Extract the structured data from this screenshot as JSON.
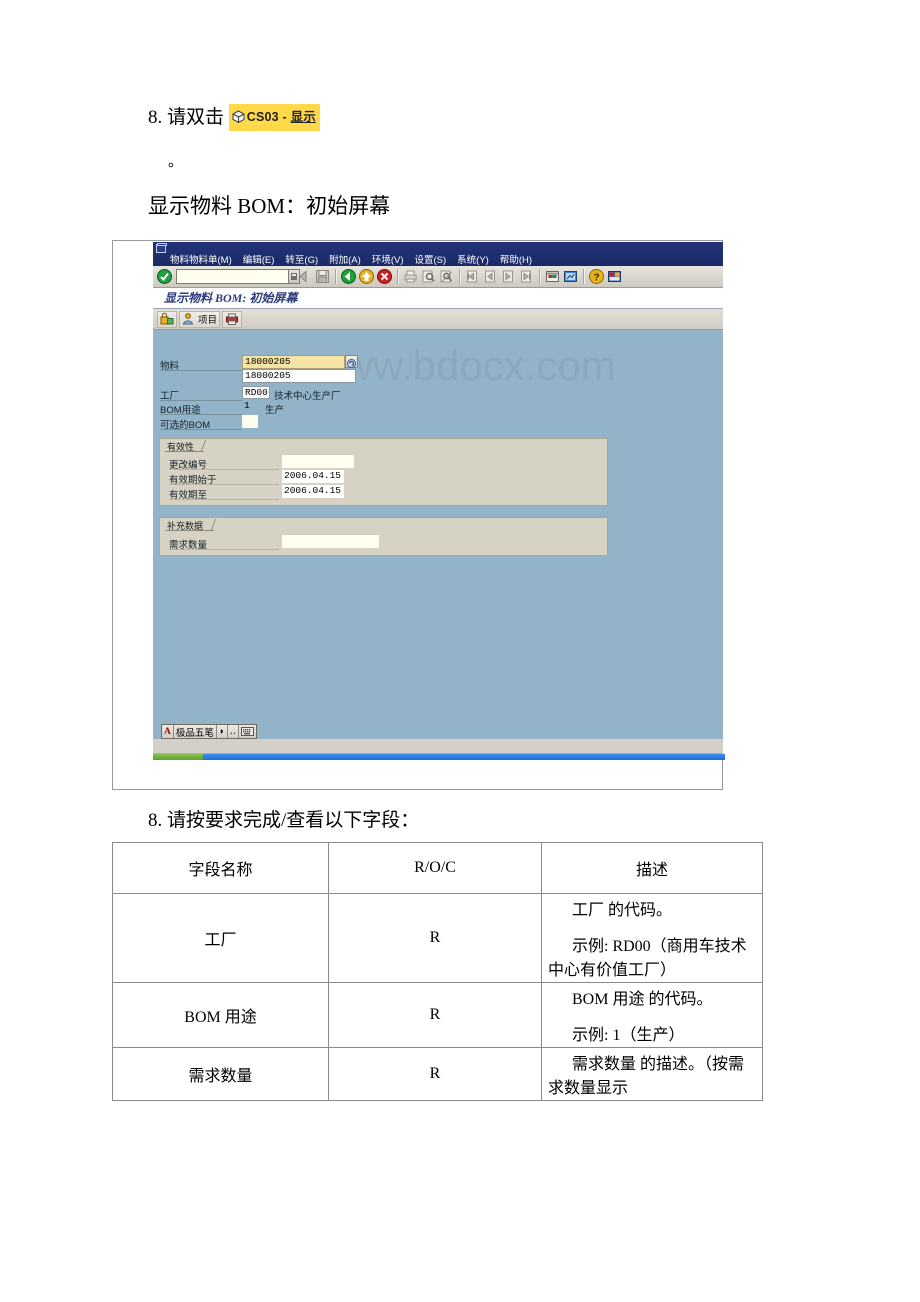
{
  "document": {
    "step_8_prefix": "8. 请双击",
    "cs_chip": {
      "code": "CS03",
      "dash": "-",
      "label": "显示",
      "icon": "cube-icon"
    },
    "dot_line": "。",
    "screen_heading": "显示物料 BOM：初始屏幕",
    "step_8_fields": "8. 请按要求完成/查看以下字段："
  },
  "sap": {
    "system_icon": "sap-system-menu-icon",
    "menus": [
      {
        "label": "物料物料单(M)",
        "accesskey": "M"
      },
      {
        "label": "编辑(E)",
        "accesskey": "E"
      },
      {
        "label": "转至(G)",
        "accesskey": "G"
      },
      {
        "label": "附加(A)",
        "accesskey": "A"
      },
      {
        "label": "环境(V)",
        "accesskey": "V"
      },
      {
        "label": "设置(S)",
        "accesskey": "S"
      },
      {
        "label": "系统(Y)",
        "accesskey": "Y"
      },
      {
        "label": "帮助(H)",
        "accesskey": "H"
      }
    ],
    "command_field": {
      "value": "",
      "placeholder": ""
    },
    "toolbar_icons": [
      "enter-green-check-icon",
      "back-arrow-icon",
      "save-icon",
      "back-green-icon",
      "exit-yellow-icon",
      "cancel-red-icon",
      "print-icon",
      "find-icon",
      "find-next-icon",
      "first-page-icon",
      "previous-page-icon",
      "next-page-icon",
      "last-page-icon",
      "create-session-icon",
      "create-shortcut-icon",
      "help-icon",
      "customize-layout-icon"
    ],
    "window_title": "显示物料 BOM:  初始屏幕",
    "app_toolbar": [
      {
        "name": "bom-group-button",
        "icon": "bom-lock-icon",
        "label": ""
      },
      {
        "name": "item-button",
        "icon": "person-icon",
        "label": "项目"
      },
      {
        "name": "print-preview-button",
        "icon": "printer-icon",
        "label": ""
      }
    ],
    "watermark": "www.bdocx.com",
    "form": {
      "material_label": "物料",
      "material_value": "18000205",
      "material_desc_value": "18000205",
      "plant_label": "工厂",
      "plant_value": "RD00",
      "plant_text": "技术中心生产厂",
      "bom_usage_label": "BOM用途",
      "bom_usage_value": "1",
      "bom_usage_text": "生产",
      "alt_bom_label": "可选的BOM",
      "alt_bom_value": "",
      "search_help_icon": "search-help-icon"
    },
    "validity_group": {
      "title": "有效性",
      "change_no_label": "更改编号",
      "change_no_value": "",
      "valid_from_label": "有效期始于",
      "valid_from_value": "2006.04.15",
      "valid_to_label": "有效期至",
      "valid_to_value": "2006.04.15"
    },
    "additional_group": {
      "title": "补充数据",
      "required_qty_label": "需求数量",
      "required_qty_value": ""
    },
    "ime": {
      "mode": "A",
      "name": "极品五笔",
      "btn_punct": "◗",
      "btn_halfwidth": "‥",
      "btn_softkeyboard": "keyboard-icon"
    }
  },
  "fields_table": {
    "headers": [
      "字段名称",
      "R/O/C",
      "描述"
    ],
    "rows": [
      {
        "name": "工厂",
        "roc": "R",
        "desc_lines": [
          "工厂 的代码。",
          "示例: RD00（商用车技术中心有价值工厂）"
        ]
      },
      {
        "name": "BOM 用途",
        "roc": "R",
        "desc_lines": [
          "BOM 用途 的代码。",
          "示例: 1（生产）"
        ]
      },
      {
        "name": "需求数量",
        "roc": "R",
        "desc_lines": [
          "需求数量 的描述。（按需求数量显示"
        ]
      }
    ]
  },
  "colors": {
    "sap_body": "#93b3c8",
    "menubar": "#1f2f6e",
    "toolbar": "#d4d0c8",
    "group_box": "#d6d3c4",
    "highlight_field": "#F5E3A4",
    "chip_yellow": "#FFD94A",
    "title_text": "#2d3c7d"
  }
}
